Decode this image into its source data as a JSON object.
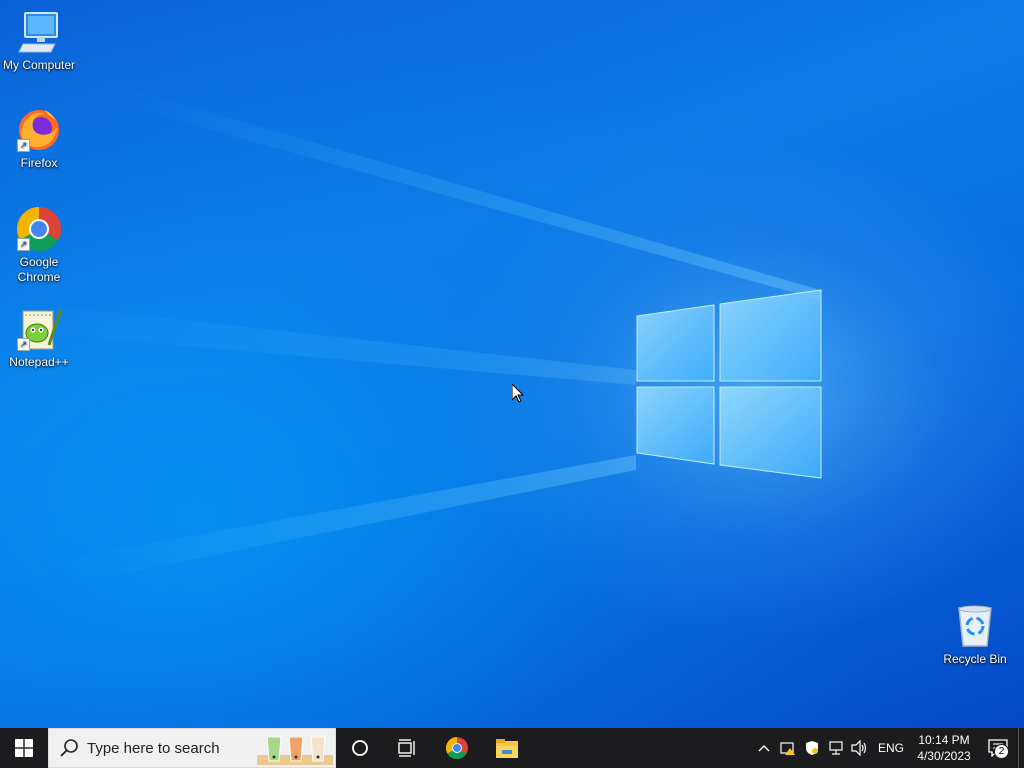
{
  "desktop": {
    "icons": [
      {
        "label": "My Computer",
        "icon": "computer-icon"
      },
      {
        "label": "Firefox",
        "icon": "firefox-icon"
      },
      {
        "label": "Google Chrome",
        "icon": "chrome-icon"
      },
      {
        "label": "Notepad++",
        "icon": "notepadpp-icon"
      },
      {
        "label": "Recycle Bin",
        "icon": "recycle-bin-icon"
      }
    ]
  },
  "taskbar": {
    "search_placeholder": "Type here to search",
    "pinned": [
      "chrome-icon",
      "file-explorer-icon"
    ],
    "tray": {
      "language": "ENG",
      "time": "10:14 PM",
      "date": "4/30/2023",
      "notification_count": "2"
    }
  },
  "colors": {
    "taskbar": "#1c1c1e",
    "desktop_accent": "#0a6fe0"
  }
}
